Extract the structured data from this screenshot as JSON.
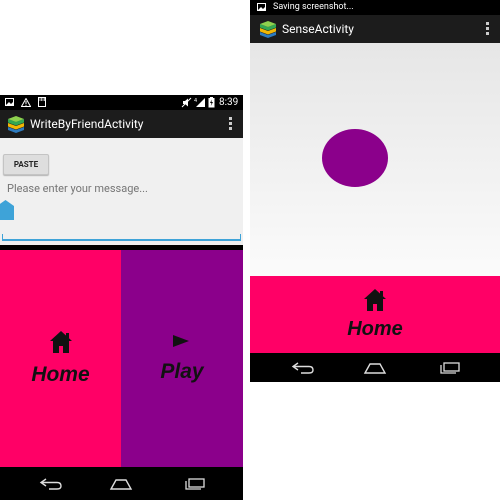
{
  "left_screen": {
    "status_time": "8:39",
    "title": "WriteByFriendActivity",
    "paste_label": "PASTE",
    "message_placeholder": "Please enter your message...",
    "home_label": "Home",
    "play_label": "Play"
  },
  "right_screen": {
    "status_text": "Saving screenshot...",
    "title": "SenseActivity",
    "home_label": "Home"
  },
  "icons": [
    "image-icon",
    "warning-icon",
    "sd-card-icon",
    "mute-icon",
    "signal-icon",
    "battery-icon",
    "app-icon",
    "overflow-menu-icon",
    "home-icon",
    "play-icon",
    "back-icon",
    "home-nav-icon",
    "recent-apps-icon"
  ],
  "colors": {
    "pink": "#ff0066",
    "purple": "#8b008b",
    "accent": "#3ea3d8",
    "action_bar": "#1c1c1c"
  }
}
